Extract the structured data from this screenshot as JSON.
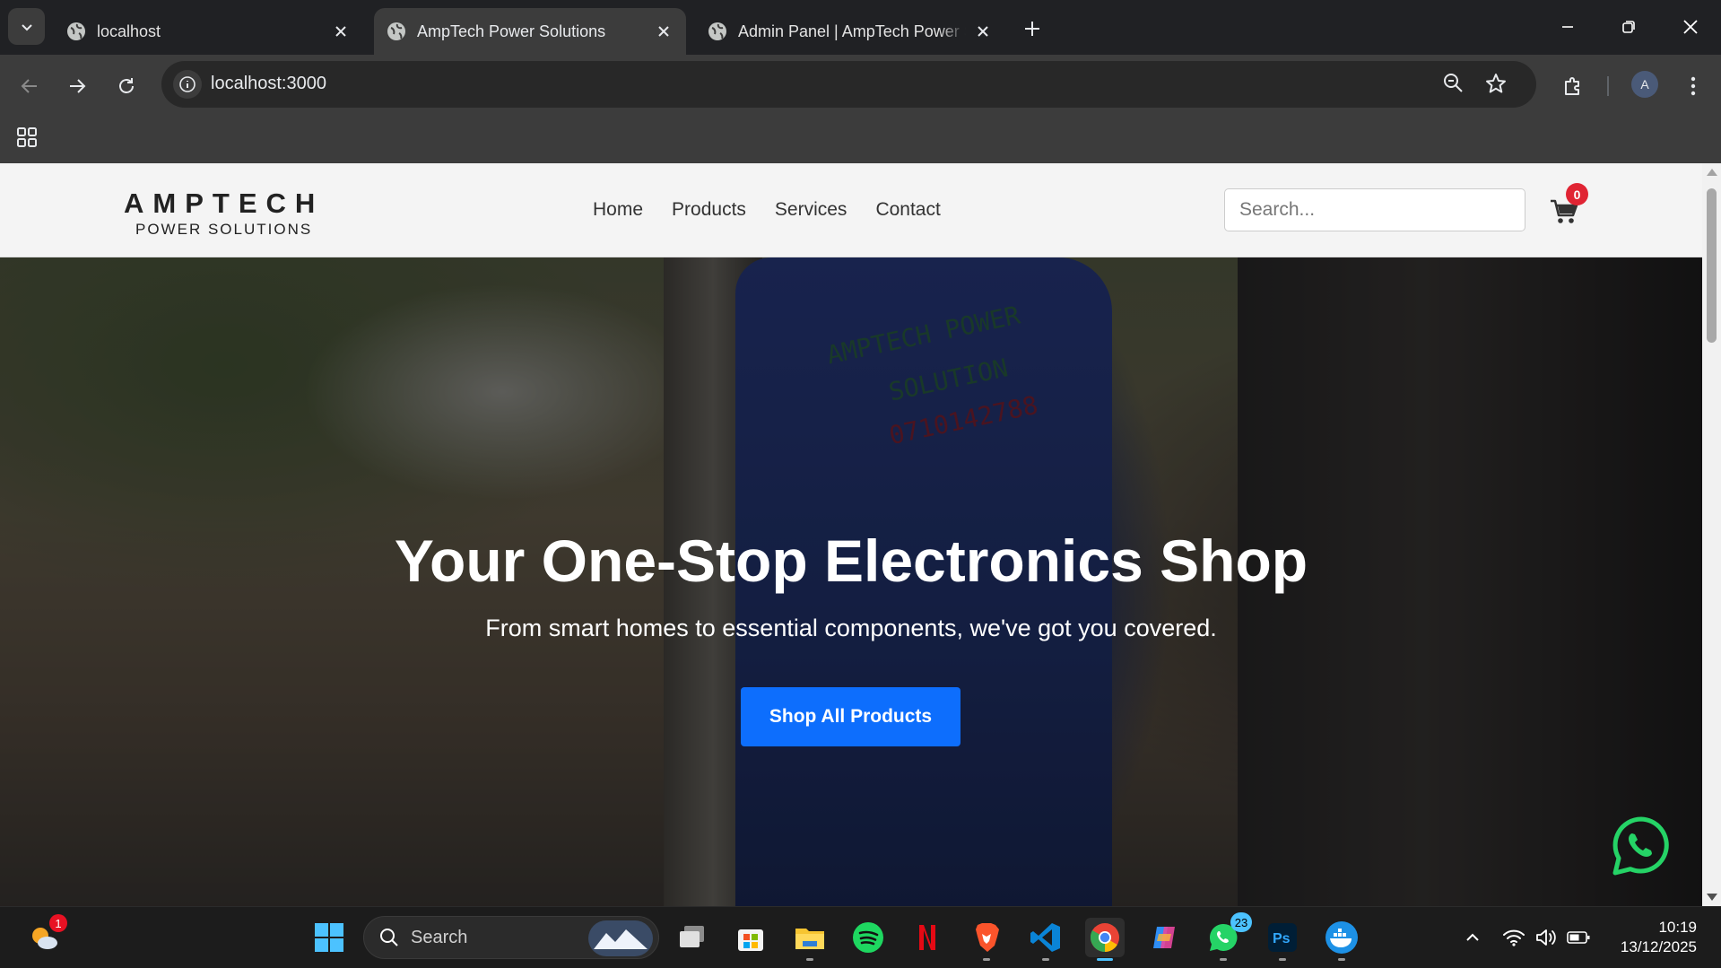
{
  "browser": {
    "tabs": [
      {
        "title": "localhost",
        "active": false
      },
      {
        "title": "AmpTech Power Solutions",
        "active": true
      },
      {
        "title": "Admin Panel | AmpTech Power Solutions",
        "active": false
      }
    ],
    "url": "localhost:3000",
    "profile_initial": "A"
  },
  "site": {
    "logo": {
      "main": "AMPTECH",
      "sub": "POWER SOLUTIONS"
    },
    "nav": [
      "Home",
      "Products",
      "Services",
      "Contact"
    ],
    "search_placeholder": "Search...",
    "cart_count": "0"
  },
  "hero": {
    "title": "Your One-Stop Electronics Shop",
    "subtitle": "From smart homes to essential components, we've got you covered.",
    "cta": "Shop All Products",
    "shirt_text_1": "AMPTECH POWER",
    "shirt_text_2": "SOLUTION",
    "shirt_phone": "0710142788"
  },
  "taskbar": {
    "weather_badge": "1",
    "search_label": "Search",
    "whatsapp_badge": "23",
    "time": "10:19",
    "date": "13/12/2025"
  },
  "colors": {
    "accent": "#0d6efd",
    "cart_badge": "#e02433",
    "whatsapp": "#25d366"
  }
}
